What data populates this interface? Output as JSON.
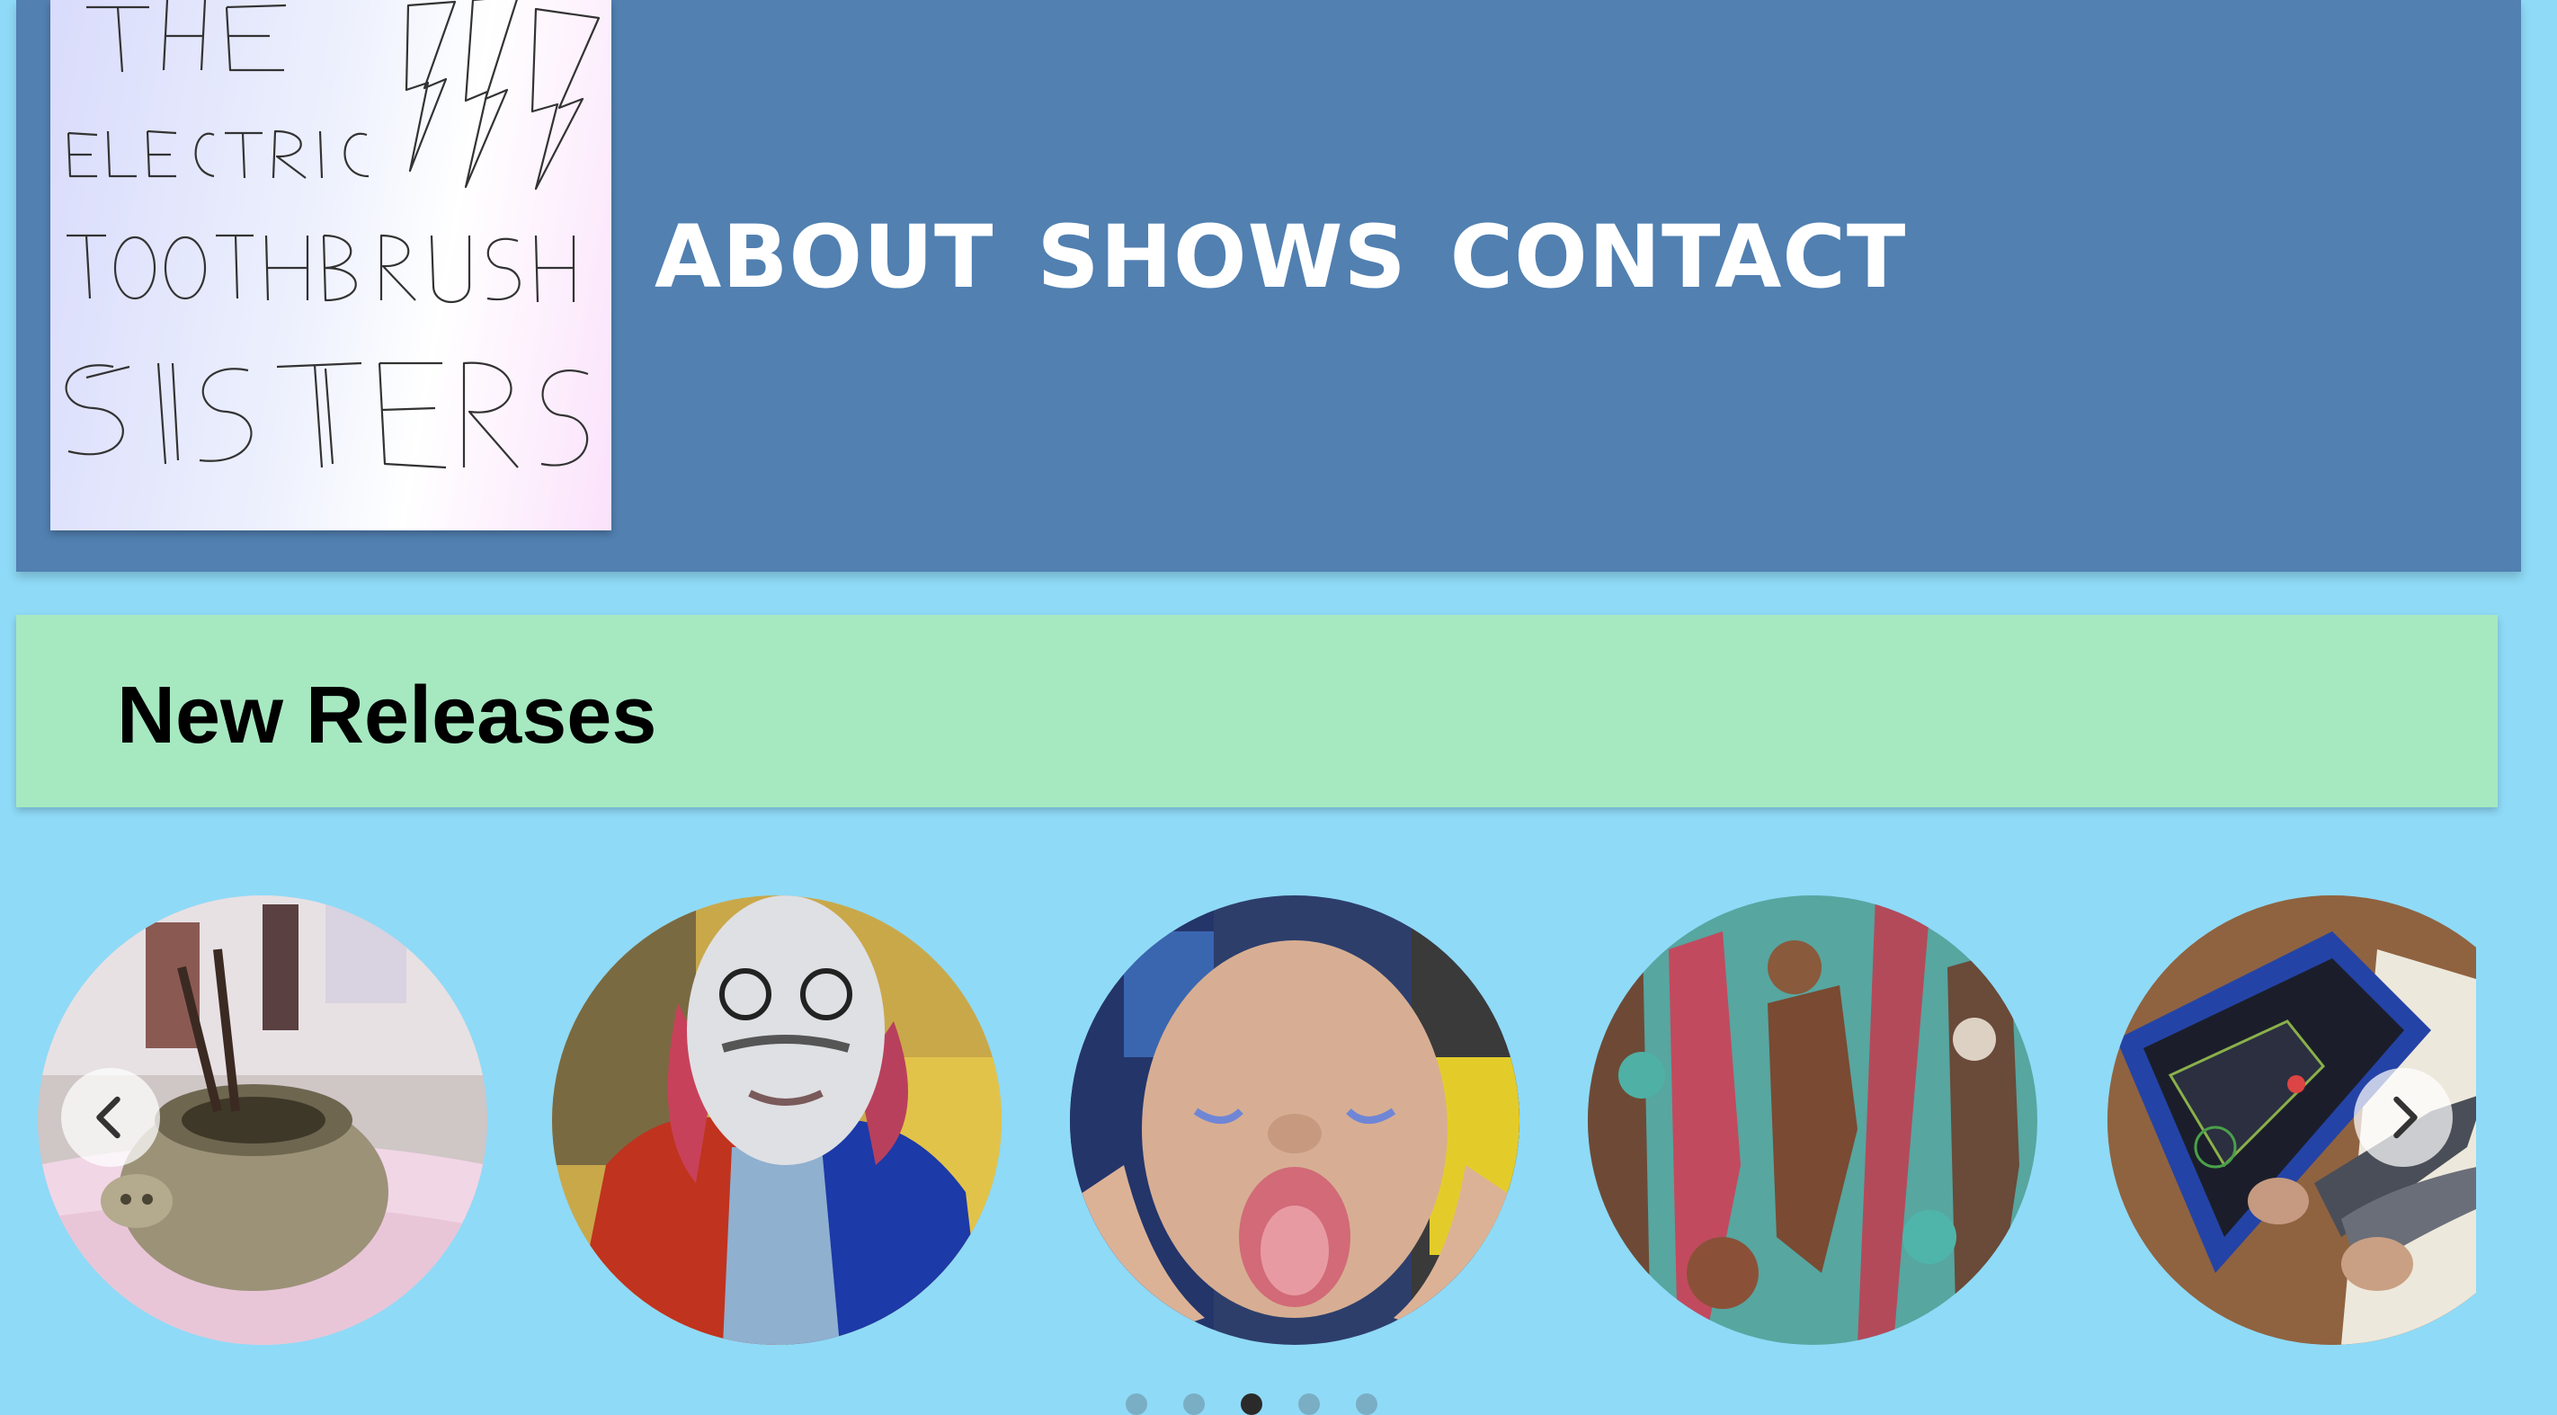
{
  "header": {
    "logo_text": [
      "THE",
      "ELECTRIC",
      "TOOTHBRUSH",
      "SISTERS"
    ],
    "nav": [
      {
        "label": "ABOUT"
      },
      {
        "label": "SHOWS"
      },
      {
        "label": "CONTACT"
      }
    ]
  },
  "releases": {
    "title": "New Releases"
  },
  "carousel": {
    "slides": [
      {
        "subject": "pig-planter-image"
      },
      {
        "subject": "masked-figure-image"
      },
      {
        "subject": "doll-head-image"
      },
      {
        "subject": "peeling-paint-image"
      },
      {
        "subject": "synth-kit-image"
      }
    ],
    "prev_icon": "chevron-left-icon",
    "next_icon": "chevron-right-icon",
    "dot_count": 5,
    "active_dot": 2
  },
  "colors": {
    "page_background": "#8fdaf7",
    "header_background": "#5180b1",
    "releases_bar": "#a6e9c1",
    "nav_text": "#ffffff"
  }
}
